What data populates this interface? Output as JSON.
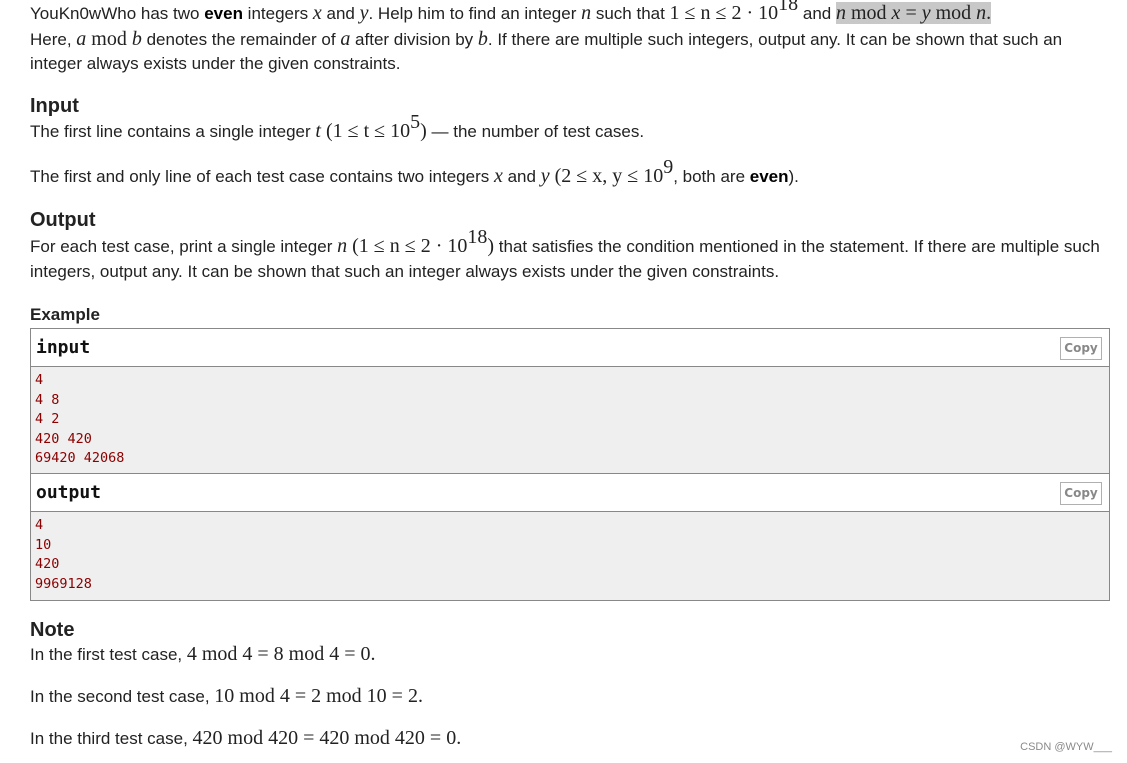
{
  "statement": {
    "p1_a": "YouKn0wWho has two ",
    "p1_bold": "even",
    "p1_b": " integers ",
    "var_x": "x",
    "and": " and ",
    "var_y": "y",
    "p1_c": ". Help him to find an integer ",
    "var_n": "n",
    "p1_d": " such that ",
    "range": "1 ≤ n ≤ 2 · 10",
    "range_exp": "18",
    "p1_e": " and ",
    "cond_n": "n",
    "cond_mod1": " mod ",
    "cond_x": "x",
    "cond_eq": " = ",
    "cond_y": "y",
    "cond_mod2": " mod ",
    "cond_n2": "n",
    "cond_dot": ".",
    "p2_a": "Here, ",
    "p2_var_a": "a",
    "p2_mod": " mod ",
    "p2_var_b": "b",
    "p2_b": " denotes the remainder of ",
    "p2_var_a2": "a",
    "p2_c": " after division by ",
    "p2_var_b2": "b",
    "p2_d": ". If there are multiple such integers, output any. It can be shown that such an integer always exists under the given constraints."
  },
  "input_section": {
    "title": "Input",
    "line1_a": "The first line contains a single integer ",
    "line1_var": "t",
    "line1_math": " (1 ≤ t ≤ 10",
    "line1_exp": "5",
    "line1_close": ")",
    "line1_b": " — the number of test cases.",
    "line2_a": "The first and only line of each test case contains two integers ",
    "line2_x": "x",
    "line2_and": " and ",
    "line2_y": "y",
    "line2_math": " (2 ≤ x, y ≤ 10",
    "line2_exp": "9",
    "line2_b": ", both are ",
    "line2_bold": "even",
    "line2_c": ")."
  },
  "output_section": {
    "title": "Output",
    "text_a": "For each test case, print a single integer ",
    "text_var": "n",
    "text_math": " (1 ≤ n ≤ 2 · 10",
    "text_exp": "18",
    "text_close": ")",
    "text_b": " that satisfies the condition mentioned in the statement. If there are multiple such integers, output any. It can be shown that such an integer always exists under the given constraints."
  },
  "example": {
    "title": "Example",
    "input_label": "input",
    "output_label": "output",
    "copy_label": "Copy",
    "input_lines": [
      "4",
      "4 8",
      "4 2",
      "420 420",
      "69420 42068"
    ],
    "output_lines": [
      "4",
      "10",
      "420",
      "9969128"
    ]
  },
  "note": {
    "title": "Note",
    "lines": [
      {
        "text": "In the first test case, ",
        "math": "4 mod 4 = 8 mod 4 = 0."
      },
      {
        "text": "In the second test case, ",
        "math": "10 mod 4 = 2 mod 10 = 2."
      },
      {
        "text": "In the third test case, ",
        "math": "420 mod 420 = 420 mod 420 = 0."
      }
    ]
  },
  "watermark": "CSDN @WYW___"
}
